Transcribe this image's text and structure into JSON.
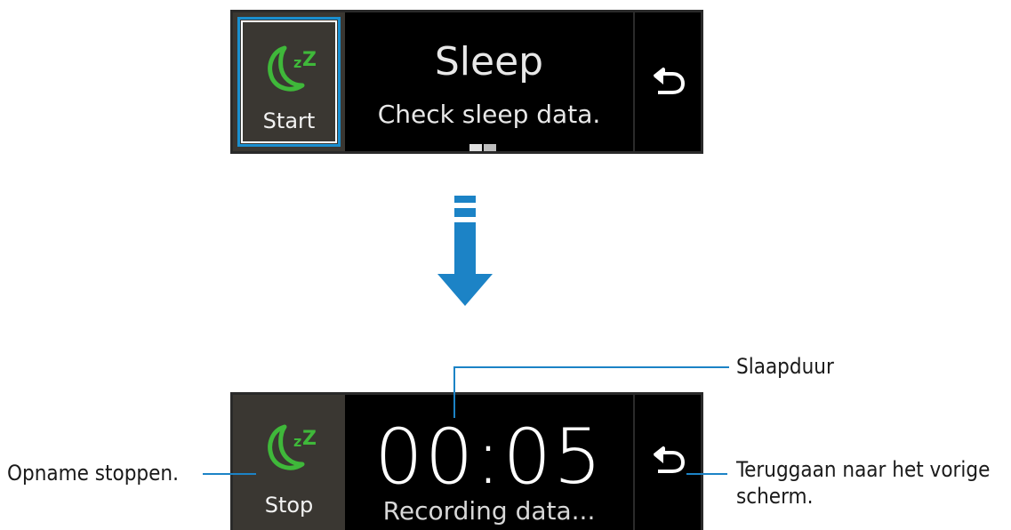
{
  "top_screen": {
    "start_label": "Start",
    "title": "Sleep",
    "subtitle": "Check sleep data."
  },
  "bottom_screen": {
    "stop_label": "Stop",
    "timer": "00:05",
    "status": "Recording data..."
  },
  "callouts": {
    "sleep_duration": "Slaapduur",
    "stop_recording": "Opname stoppen.",
    "go_back_line1": "Teruggaan naar het vorige",
    "go_back_line2": "scherm."
  },
  "icons": {
    "moon": "sleep-moon-icon",
    "back": "back-arrow-icon",
    "transition": "down-arrow-icon"
  },
  "colors": {
    "accent_green": "#3fb83a",
    "callout_blue": "#1c83c6",
    "focus_blue": "#1a8fd0"
  }
}
